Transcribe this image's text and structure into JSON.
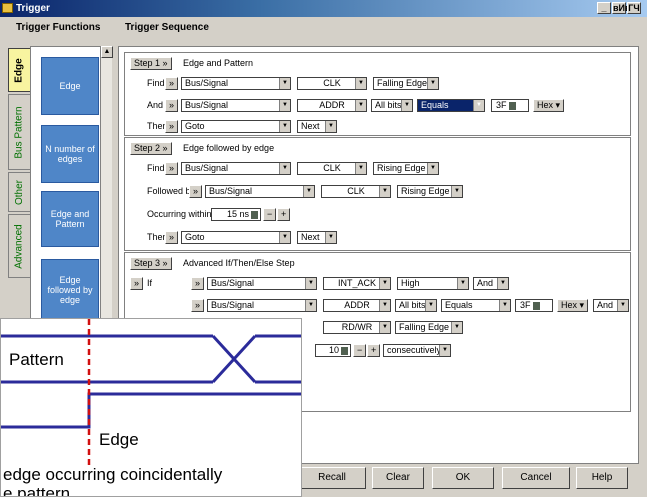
{
  "window": {
    "title": "Trigger",
    "controls": [
      "_",
      "вИв",
      "ГЧ"
    ]
  },
  "header": {
    "functions": "Trigger Functions",
    "sequence": "Trigger Sequence"
  },
  "tabs": [
    "Edge",
    "Bus Pattern",
    "Other",
    "Advanced"
  ],
  "functions": [
    "Edge",
    "N number of edges",
    "Edge and Pattern",
    "Edge followed by edge"
  ],
  "step1": {
    "btn": "Step 1",
    "arrow": "»",
    "title": "Edge and Pattern",
    "find": "Find",
    "and": "And",
    "then": "Then",
    "r1": [
      "Bus/Signal",
      "CLK",
      "Falling Edge"
    ],
    "r2": [
      "Bus/Signal",
      "ADDR",
      "All bits",
      "Equals",
      "3F",
      "Hex"
    ],
    "r3": [
      "Goto",
      "Next"
    ]
  },
  "step2": {
    "btn": "Step 2",
    "title": "Edge followed by edge",
    "find": "Find",
    "followed": "Followed by",
    "occurring": "Occurring within",
    "then": "Then",
    "r1": [
      "Bus/Signal",
      "CLK",
      "Rising Edge"
    ],
    "r2": [
      "Bus/Signal",
      "CLK",
      "Rising Edge"
    ],
    "r3": [
      "15 ns",
      "−",
      "+"
    ],
    "r4": [
      "Goto",
      "Next"
    ]
  },
  "step3": {
    "btn": "Step 3",
    "title": "Advanced If/Then/Else Step",
    "if": "If",
    "r1": [
      "Bus/Signal",
      "INT_ACK",
      "High",
      "And"
    ],
    "r2": [
      "Bus/Signal",
      "ADDR",
      "All bits",
      "Equals",
      "3F",
      "Hex",
      "And"
    ],
    "r3": [
      "RD/WR",
      "Falling Edge"
    ],
    "r4": [
      "10",
      "−",
      "+",
      "consecutively"
    ]
  },
  "buttons": [
    "Recall",
    "Clear",
    "OK",
    "Cancel",
    "Help"
  ],
  "overlay": {
    "pattern": "Pattern",
    "edge": "Edge",
    "line1": "edge occurring coincidentally",
    "line2": "e pattern"
  }
}
